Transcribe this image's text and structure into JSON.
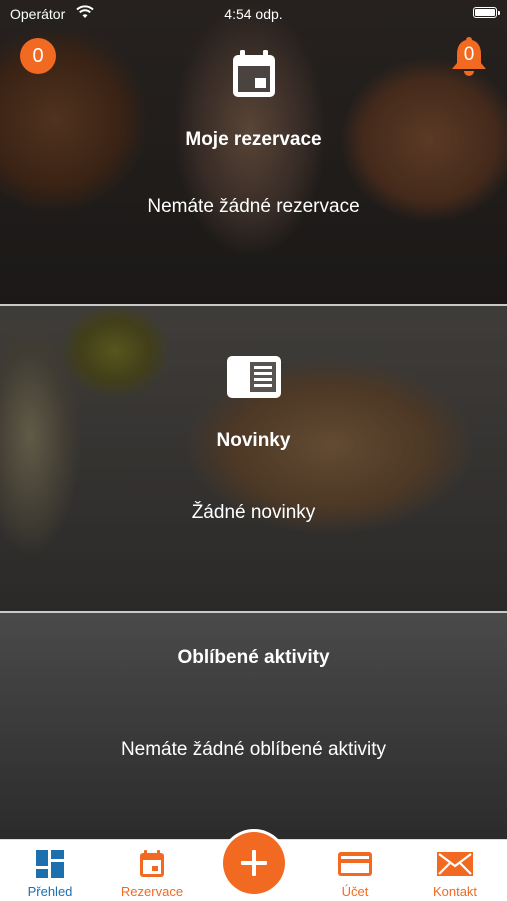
{
  "status_bar": {
    "carrier": "Operátor",
    "time": "4:54 odp."
  },
  "header": {
    "left_counter": "0",
    "notification_count": "0"
  },
  "sections": {
    "reservations": {
      "title": "Moje rezervace",
      "text": "Nemáte žádné rezervace",
      "icon": "calendar-icon"
    },
    "news": {
      "title": "Novinky",
      "text": "Žádné novinky",
      "icon": "newspaper-icon"
    },
    "favorites": {
      "title": "Oblíbené aktivity",
      "text": "Nemáte žádné oblíbené aktivity"
    }
  },
  "tab_bar": {
    "items": [
      {
        "label": "Přehled",
        "icon": "dashboard-icon",
        "active": true
      },
      {
        "label": "Rezervace",
        "icon": "calendar-icon",
        "active": false
      },
      {
        "label": "Účet",
        "icon": "credit-card-icon",
        "active": false
      },
      {
        "label": "Kontakt",
        "icon": "envelope-icon",
        "active": false
      }
    ],
    "fab_icon": "plus-icon"
  },
  "colors": {
    "accent": "#f26a21",
    "active_tab": "#1d6fae"
  }
}
